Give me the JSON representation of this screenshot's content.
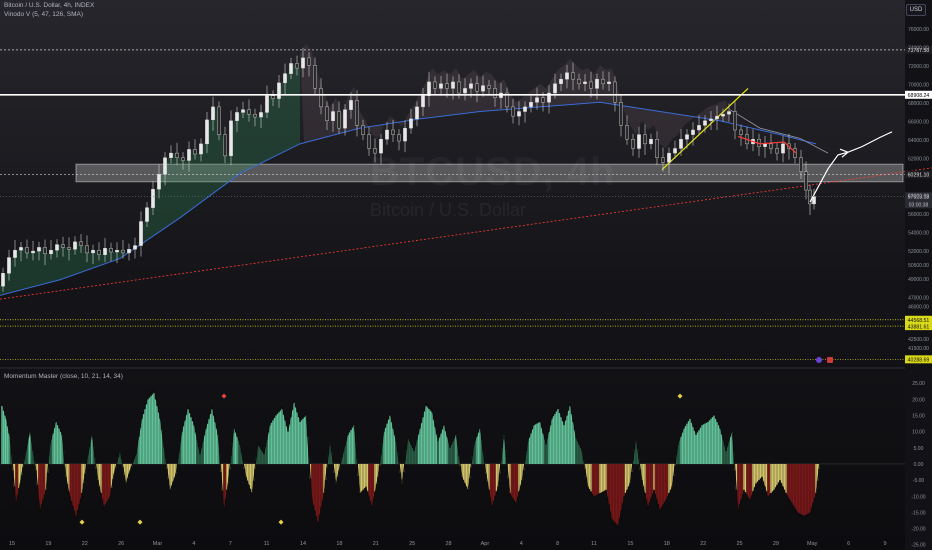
{
  "header": {
    "symbol_line": "Bitcoin / U.S. Dollar, 4h, INDEX",
    "indicator_line": "Vinodo V (5, 47, 126, SMA)",
    "oscillator_title": "Momentum Master (close, 10, 21, 14, 34)",
    "currency": "USD"
  },
  "watermark": {
    "main": "BTCUSD, 4h",
    "sub": "Bitcoin / U.S. Dollar"
  },
  "colors": {
    "background": "#101014",
    "bull_candle": "#e8e8e8",
    "bear_candle": "#2a2a2a",
    "level_line": "#ffffff",
    "support_zone": "#d9d9d9",
    "trend_red": "#ff3b3b",
    "yellow": "#e6e600",
    "ma_blue": "#3a6bd6",
    "cloud_green": "#2f8f5a",
    "hist_green": "#6fe0b0",
    "hist_darkgreen": "#1e6b2a",
    "hist_yellow": "#f2e37a",
    "hist_red": "#8b1a1a"
  },
  "chart_data": [
    {
      "type": "candlestick",
      "ylim": [
        40000,
        77000
      ],
      "y_ticks": [
        76000,
        74000,
        72000,
        70000,
        68000,
        66000,
        64000,
        62000,
        58000,
        56000,
        54000,
        52000,
        50500,
        49000,
        47000,
        46000,
        42500,
        41500
      ],
      "x_ticks": [
        "15",
        "19",
        "22",
        "26",
        "Mar",
        "4",
        "7",
        "11",
        "14",
        "18",
        "21",
        "25",
        "28",
        "Apr",
        "4",
        "8",
        "11",
        "15",
        "18",
        "22",
        "25",
        "29",
        "May",
        "6",
        "9"
      ],
      "price_labels": [
        {
          "value": 73767.5,
          "label": "73767.50",
          "style": "dotted"
        },
        {
          "value": 68908.24,
          "label": "68908.24",
          "style": "solid"
        },
        {
          "value": 60291.1,
          "label": "60291.10",
          "style": "dotted"
        },
        {
          "value": 57923.18,
          "label": "57923.18",
          "style": "current",
          "sub": "03:00:38"
        },
        {
          "value": 44568.51,
          "label": "44568.51",
          "style": "yellow"
        },
        {
          "value": 43881.61,
          "label": "43881.61",
          "style": "yellow"
        },
        {
          "value": 40288.69,
          "label": "40288.69",
          "style": "yellow"
        }
      ],
      "support_zone": [
        59500,
        61400
      ],
      "close_path": [
        [
          0,
          48200
        ],
        [
          6,
          49600
        ],
        [
          12,
          51300
        ],
        [
          18,
          52100
        ],
        [
          24,
          52400
        ],
        [
          30,
          51800
        ],
        [
          36,
          52000
        ],
        [
          42,
          52400
        ],
        [
          48,
          51700
        ],
        [
          54,
          52100
        ],
        [
          60,
          52700
        ],
        [
          66,
          52400
        ],
        [
          72,
          52200
        ],
        [
          78,
          53000
        ],
        [
          84,
          52600
        ],
        [
          90,
          51800
        ],
        [
          96,
          52100
        ],
        [
          102,
          51600
        ],
        [
          108,
          52300
        ],
        [
          114,
          51900
        ],
        [
          120,
          52100
        ],
        [
          126,
          51800
        ],
        [
          132,
          52200
        ],
        [
          138,
          52600
        ],
        [
          144,
          55200
        ],
        [
          150,
          56700
        ],
        [
          156,
          58700
        ],
        [
          162,
          60300
        ],
        [
          168,
          62100
        ],
        [
          174,
          62600
        ],
        [
          180,
          62100
        ],
        [
          186,
          61800
        ],
        [
          192,
          63000
        ],
        [
          198,
          62500
        ],
        [
          204,
          63600
        ],
        [
          210,
          66200
        ],
        [
          216,
          67600
        ],
        [
          222,
          64600
        ],
        [
          228,
          62300
        ],
        [
          234,
          66100
        ],
        [
          240,
          67000
        ],
        [
          246,
          67300
        ],
        [
          252,
          66800
        ],
        [
          258,
          66500
        ],
        [
          264,
          67000
        ],
        [
          270,
          68800
        ],
        [
          276,
          68500
        ],
        [
          282,
          70200
        ],
        [
          288,
          71200
        ],
        [
          294,
          72300
        ],
        [
          300,
          71800
        ],
        [
          306,
          72900
        ],
        [
          312,
          72100
        ],
        [
          318,
          69600
        ],
        [
          324,
          67600
        ],
        [
          330,
          66100
        ],
        [
          336,
          67100
        ],
        [
          342,
          65300
        ],
        [
          348,
          67300
        ],
        [
          354,
          68300
        ],
        [
          360,
          65600
        ],
        [
          366,
          64600
        ],
        [
          372,
          63100
        ],
        [
          378,
          62600
        ],
        [
          384,
          64100
        ],
        [
          390,
          65100
        ],
        [
          396,
          64600
        ],
        [
          402,
          63900
        ],
        [
          408,
          65300
        ],
        [
          414,
          66300
        ],
        [
          420,
          67600
        ],
        [
          426,
          68800
        ],
        [
          432,
          70300
        ],
        [
          438,
          69600
        ],
        [
          444,
          70100
        ],
        [
          450,
          69600
        ],
        [
          456,
          70300
        ],
        [
          462,
          69100
        ],
        [
          468,
          69600
        ],
        [
          474,
          70100
        ],
        [
          480,
          69300
        ],
        [
          486,
          69900
        ],
        [
          492,
          69600
        ],
        [
          498,
          68600
        ],
        [
          504,
          69100
        ],
        [
          510,
          67600
        ],
        [
          516,
          66600
        ],
        [
          522,
          67100
        ],
        [
          528,
          67600
        ],
        [
          534,
          68100
        ],
        [
          540,
          68600
        ],
        [
          546,
          68100
        ],
        [
          552,
          69100
        ],
        [
          558,
          70100
        ],
        [
          564,
          70600
        ],
        [
          570,
          71300
        ],
        [
          576,
          70600
        ],
        [
          582,
          70100
        ],
        [
          588,
          70300
        ],
        [
          594,
          69600
        ],
        [
          600,
          70600
        ],
        [
          606,
          70100
        ],
        [
          612,
          70300
        ],
        [
          618,
          68100
        ],
        [
          624,
          65600
        ],
        [
          630,
          64100
        ],
        [
          636,
          63100
        ],
        [
          642,
          64600
        ],
        [
          648,
          63600
        ],
        [
          654,
          64100
        ],
        [
          660,
          62100
        ],
        [
          666,
          61600
        ],
        [
          672,
          62600
        ],
        [
          678,
          63100
        ],
        [
          684,
          64100
        ],
        [
          690,
          64600
        ],
        [
          696,
          65100
        ],
        [
          702,
          65600
        ],
        [
          708,
          66100
        ],
        [
          714,
          66300
        ],
        [
          720,
          66600
        ],
        [
          726,
          66800
        ],
        [
          732,
          67100
        ],
        [
          738,
          65100
        ],
        [
          744,
          64600
        ],
        [
          750,
          63600
        ],
        [
          756,
          64100
        ],
        [
          762,
          63300
        ],
        [
          768,
          63600
        ],
        [
          774,
          63100
        ],
        [
          780,
          62600
        ],
        [
          786,
          63600
        ],
        [
          792,
          63100
        ],
        [
          798,
          62100
        ],
        [
          804,
          60600
        ],
        [
          808,
          58600
        ],
        [
          812,
          57100
        ],
        [
          816,
          57900
        ]
      ],
      "moving_average": [
        [
          0,
          47200
        ],
        [
          60,
          48900
        ],
        [
          120,
          51200
        ],
        [
          180,
          55600
        ],
        [
          240,
          60400
        ],
        [
          300,
          63600
        ],
        [
          360,
          65300
        ],
        [
          420,
          66300
        ],
        [
          480,
          67100
        ],
        [
          540,
          67600
        ],
        [
          600,
          68100
        ],
        [
          660,
          67100
        ],
        [
          720,
          66100
        ],
        [
          780,
          64600
        ],
        [
          816,
          63600
        ]
      ],
      "trend_lines": [
        {
          "name": "rising-trend",
          "color": "yellow",
          "from": [
            662,
            60800
          ],
          "to": [
            748,
            69600
          ]
        },
        {
          "name": "long-support",
          "color": "red",
          "from": [
            0,
            46800
          ],
          "to": [
            932,
            61000
          ]
        }
      ],
      "red_ma": [
        [
          738,
          64400
        ],
        [
          760,
          63600
        ],
        [
          784,
          63800
        ],
        [
          796,
          62600
        ]
      ],
      "projection": [
        [
          810,
          57300
        ],
        [
          818,
          58900
        ],
        [
          828,
          60900
        ],
        [
          838,
          62400
        ],
        [
          848,
          62700
        ],
        [
          862,
          63300
        ],
        [
          880,
          64300
        ],
        [
          892,
          64900
        ]
      ],
      "forecast_band": [
        [
          730,
          67300
        ],
        [
          760,
          65300
        ],
        [
          800,
          64200
        ],
        [
          828,
          62600
        ]
      ]
    },
    {
      "type": "histogram",
      "title": "Momentum Master (close, 10, 21, 14, 34)",
      "ylim": [
        -22,
        26
      ],
      "y_ticks": [
        25.0,
        20.0,
        15.0,
        10.0,
        5.0,
        0.0,
        -5.0,
        -10.0,
        -15.0,
        -20.0,
        -25.0
      ],
      "bars": [
        [
          2,
          18
        ],
        [
          6,
          14
        ],
        [
          10,
          8
        ],
        [
          16,
          -12
        ],
        [
          20,
          -6
        ],
        [
          26,
          4
        ],
        [
          30,
          10
        ],
        [
          36,
          -2
        ],
        [
          40,
          -14
        ],
        [
          46,
          -8
        ],
        [
          50,
          6
        ],
        [
          56,
          13
        ],
        [
          62,
          9
        ],
        [
          66,
          -4
        ],
        [
          70,
          -10
        ],
        [
          76,
          -16
        ],
        [
          82,
          -9
        ],
        [
          88,
          3
        ],
        [
          92,
          9
        ],
        [
          98,
          -5
        ],
        [
          104,
          -13
        ],
        [
          110,
          -10
        ],
        [
          114,
          -3
        ],
        [
          120,
          4
        ],
        [
          126,
          -6
        ],
        [
          130,
          -2
        ],
        [
          136,
          3
        ],
        [
          142,
          14
        ],
        [
          148,
          20
        ],
        [
          154,
          22
        ],
        [
          160,
          14
        ],
        [
          164,
          5
        ],
        [
          170,
          -8
        ],
        [
          176,
          -3
        ],
        [
          182,
          10
        ],
        [
          188,
          17
        ],
        [
          194,
          12
        ],
        [
          200,
          3
        ],
        [
          206,
          11
        ],
        [
          212,
          17
        ],
        [
          218,
          9
        ],
        [
          224,
          -14
        ],
        [
          228,
          -6
        ],
        [
          234,
          11
        ],
        [
          240,
          6
        ],
        [
          246,
          -4
        ],
        [
          252,
          -9
        ],
        [
          258,
          6
        ],
        [
          264,
          3
        ],
        [
          270,
          12
        ],
        [
          276,
          15
        ],
        [
          282,
          17
        ],
        [
          288,
          10
        ],
        [
          294,
          19
        ],
        [
          300,
          13
        ],
        [
          306,
          15
        ],
        [
          312,
          -11
        ],
        [
          318,
          -18
        ],
        [
          324,
          -9
        ],
        [
          330,
          7
        ],
        [
          336,
          -6
        ],
        [
          342,
          2
        ],
        [
          348,
          9
        ],
        [
          354,
          12
        ],
        [
          360,
          -9
        ],
        [
          366,
          -7
        ],
        [
          372,
          -13
        ],
        [
          378,
          -4
        ],
        [
          384,
          10
        ],
        [
          390,
          15
        ],
        [
          396,
          7
        ],
        [
          402,
          -6
        ],
        [
          408,
          8
        ],
        [
          414,
          4
        ],
        [
          420,
          11
        ],
        [
          426,
          18
        ],
        [
          432,
          16
        ],
        [
          438,
          7
        ],
        [
          444,
          12
        ],
        [
          450,
          5
        ],
        [
          456,
          9
        ],
        [
          462,
          -4
        ],
        [
          468,
          -8
        ],
        [
          474,
          6
        ],
        [
          480,
          11
        ],
        [
          486,
          -3
        ],
        [
          492,
          -13
        ],
        [
          498,
          -7
        ],
        [
          504,
          9
        ],
        [
          510,
          -9
        ],
        [
          516,
          -12
        ],
        [
          522,
          -5
        ],
        [
          528,
          7
        ],
        [
          534,
          12
        ],
        [
          540,
          13
        ],
        [
          546,
          6
        ],
        [
          552,
          14
        ],
        [
          558,
          17
        ],
        [
          564,
          12
        ],
        [
          570,
          18
        ],
        [
          576,
          8
        ],
        [
          582,
          4
        ],
        [
          588,
          -7
        ],
        [
          594,
          -10
        ],
        [
          600,
          -9
        ],
        [
          606,
          -8
        ],
        [
          612,
          -17
        ],
        [
          618,
          -19
        ],
        [
          624,
          -10
        ],
        [
          630,
          -6
        ],
        [
          636,
          8
        ],
        [
          642,
          -5
        ],
        [
          648,
          -13
        ],
        [
          654,
          -8
        ],
        [
          660,
          -14
        ],
        [
          666,
          -11
        ],
        [
          672,
          -7
        ],
        [
          678,
          6
        ],
        [
          684,
          11
        ],
        [
          690,
          14
        ],
        [
          696,
          9
        ],
        [
          702,
          12
        ],
        [
          708,
          13
        ],
        [
          714,
          15
        ],
        [
          720,
          11
        ],
        [
          726,
          4
        ],
        [
          732,
          10
        ],
        [
          738,
          -14
        ],
        [
          744,
          -8
        ],
        [
          750,
          -11
        ],
        [
          756,
          -6
        ],
        [
          762,
          -4
        ],
        [
          768,
          -10
        ],
        [
          774,
          -8
        ],
        [
          780,
          -5
        ],
        [
          786,
          -9
        ],
        [
          792,
          -12
        ],
        [
          798,
          -15
        ],
        [
          804,
          -16
        ],
        [
          810,
          -15
        ],
        [
          816,
          -9
        ],
        [
          820,
          1
        ]
      ],
      "markers": [
        {
          "x": 224,
          "y": 21,
          "color": "#e0463a"
        },
        {
          "x": 680,
          "y": 21,
          "color": "#e8d14a"
        },
        {
          "x": 82,
          "y": -18,
          "color": "#e8d14a"
        },
        {
          "x": 140,
          "y": -18,
          "color": "#e8d14a"
        },
        {
          "x": 281,
          "y": -18,
          "color": "#e8d14a"
        }
      ]
    }
  ]
}
